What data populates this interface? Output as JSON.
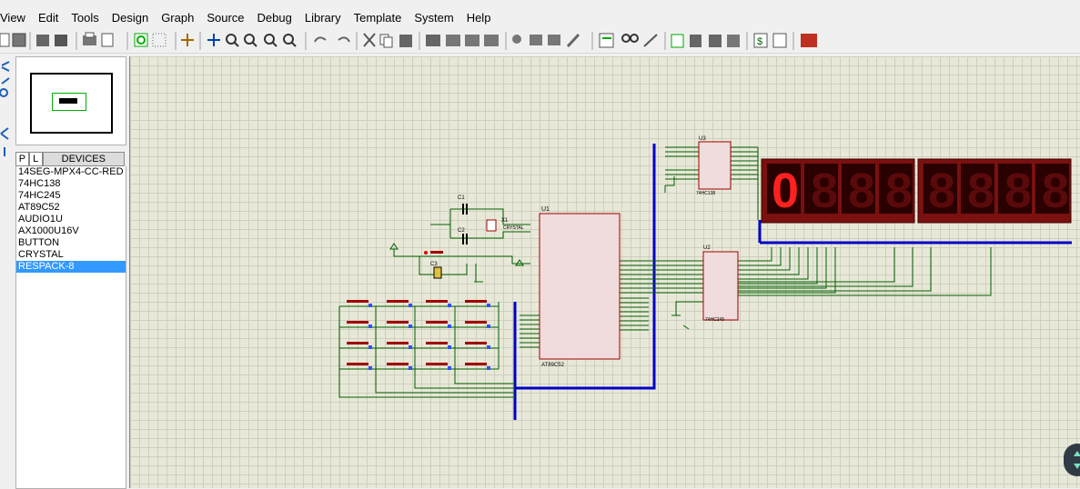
{
  "menu": [
    "View",
    "Edit",
    "Tools",
    "Design",
    "Graph",
    "Source",
    "Debug",
    "Library",
    "Template",
    "System",
    "Help"
  ],
  "device_panel": {
    "tab_p": "P",
    "tab_l": "L",
    "header": "DEVICES",
    "items": [
      "14SEG-MPX4-CC-RED",
      "74HC138",
      "74HC245",
      "AT89C52",
      "AUDIO1U",
      "AX1000U16V",
      "BUTTON",
      "CRYSTAL",
      "RESPACK-8"
    ],
    "selected": "RESPACK-8"
  },
  "schematic": {
    "u1_ref": "U1",
    "u1_part": "AT89C52",
    "u2_ref": "U2",
    "u2_part": "74HC245",
    "u3_ref": "U3",
    "u3_part": "74HC138",
    "x1_ref": "X1",
    "x1_part": "CRYSTAL",
    "c1_ref": "C1",
    "c2_ref": "C2",
    "c3_ref": "C3",
    "display_digit": "0",
    "text_placeholder": "<TEXT>"
  },
  "colors": {
    "canvas": "#e8e8d8",
    "wire": "#006000",
    "bus": "#0000c8",
    "chip_fill": "#f0dcdc",
    "chip_border": "#a00000",
    "display_bg": "#2a0000",
    "segment_on": "#ff2020",
    "segment_off": "#5a0a0a",
    "selection": "#3399ff"
  }
}
